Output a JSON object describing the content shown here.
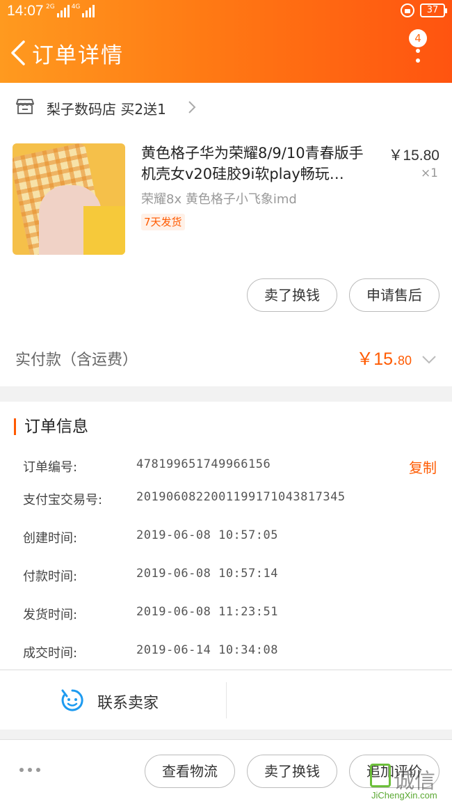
{
  "status_bar": {
    "time": "14:07",
    "net1": "2G",
    "net2": "4G",
    "battery": "37"
  },
  "header": {
    "title": "订单详情",
    "badge_count": "4"
  },
  "shop": {
    "name": "梨子数码店 买2送1"
  },
  "product": {
    "name": "黄色格子华为荣耀8/9/10青春版手机壳女v20硅胶9i软play畅玩…",
    "price": "￥15.80",
    "qty": "×1",
    "sku": "荣耀8x  黄色格子小飞象imd",
    "tag": "7天发货"
  },
  "item_actions": {
    "sell": "卖了换钱",
    "after_sale": "申请售后"
  },
  "payment": {
    "label": "实付款（含运费）",
    "amount_main": "￥15.",
    "amount_cents": "80"
  },
  "order_info": {
    "title": "订单信息",
    "copy_label": "复制",
    "rows": [
      {
        "label": "订单编号:",
        "value": "478199651749966156"
      },
      {
        "label": "支付宝交易号:",
        "value": "2019060822001199171043817345"
      },
      {
        "label": "创建时间:",
        "value": "2019-06-08  10:57:05"
      },
      {
        "label": "付款时间:",
        "value": "2019-06-08  10:57:14"
      },
      {
        "label": "发货时间:",
        "value": "2019-06-08  11:23:51"
      },
      {
        "label": "成交时间:",
        "value": "2019-06-14  10:34:08"
      }
    ]
  },
  "contact": {
    "label": "联系卖家"
  },
  "bottom_bar": {
    "logistics": "查看物流",
    "sell": "卖了换钱",
    "review": "追加评价"
  },
  "watermark": {
    "text": "诚信",
    "url": "JiChengXin.com"
  },
  "colors": {
    "accent": "#ff5a00",
    "header_start": "#ff9a1f",
    "header_end": "#ff5410",
    "contact_icon": "#1e9bf0"
  },
  "icons": [
    "back-arrow-icon",
    "more-vertical-icon",
    "shop-icon",
    "chevron-right-icon",
    "chevron-down-icon",
    "chat-face-icon",
    "more-horizontal-icon"
  ]
}
